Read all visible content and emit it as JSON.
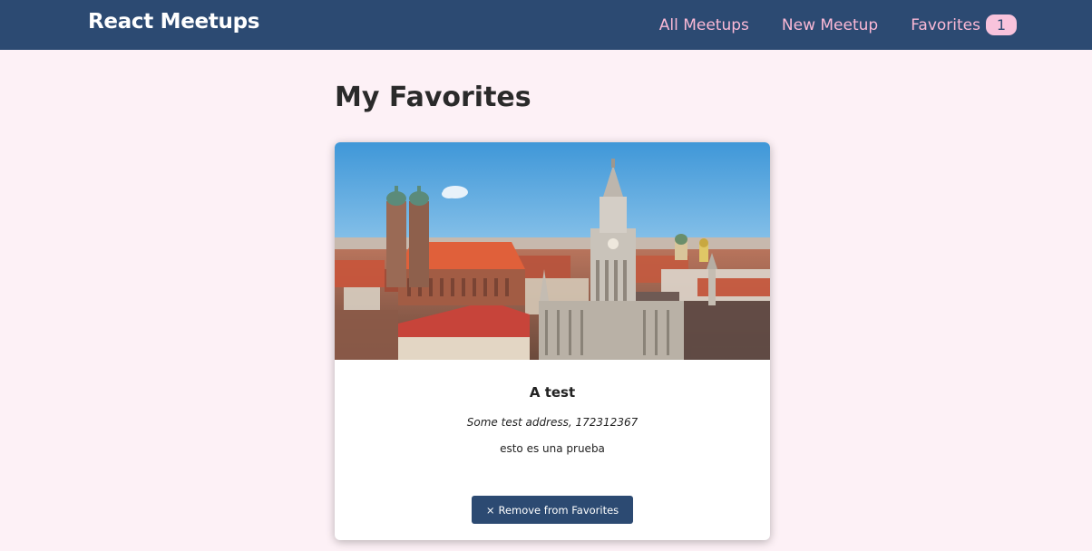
{
  "header": {
    "logo": "React Meetups",
    "nav": {
      "all_meetups": "All Meetups",
      "new_meetup": "New Meetup",
      "favorites": "Favorites",
      "favorites_count": "1"
    }
  },
  "main": {
    "title": "My Favorites",
    "meetups": [
      {
        "title": "A test",
        "address": "Some test address, 172312367",
        "description": "esto es una prueba",
        "remove_label": "Remove from Favorites",
        "remove_icon": "×"
      }
    ]
  },
  "colors": {
    "header_bg": "#2c4a72",
    "nav_link": "#fbb9d6",
    "badge_bg": "#f8c3dc",
    "page_bg": "#fdf1f6",
    "button_bg": "#2c4a72"
  }
}
